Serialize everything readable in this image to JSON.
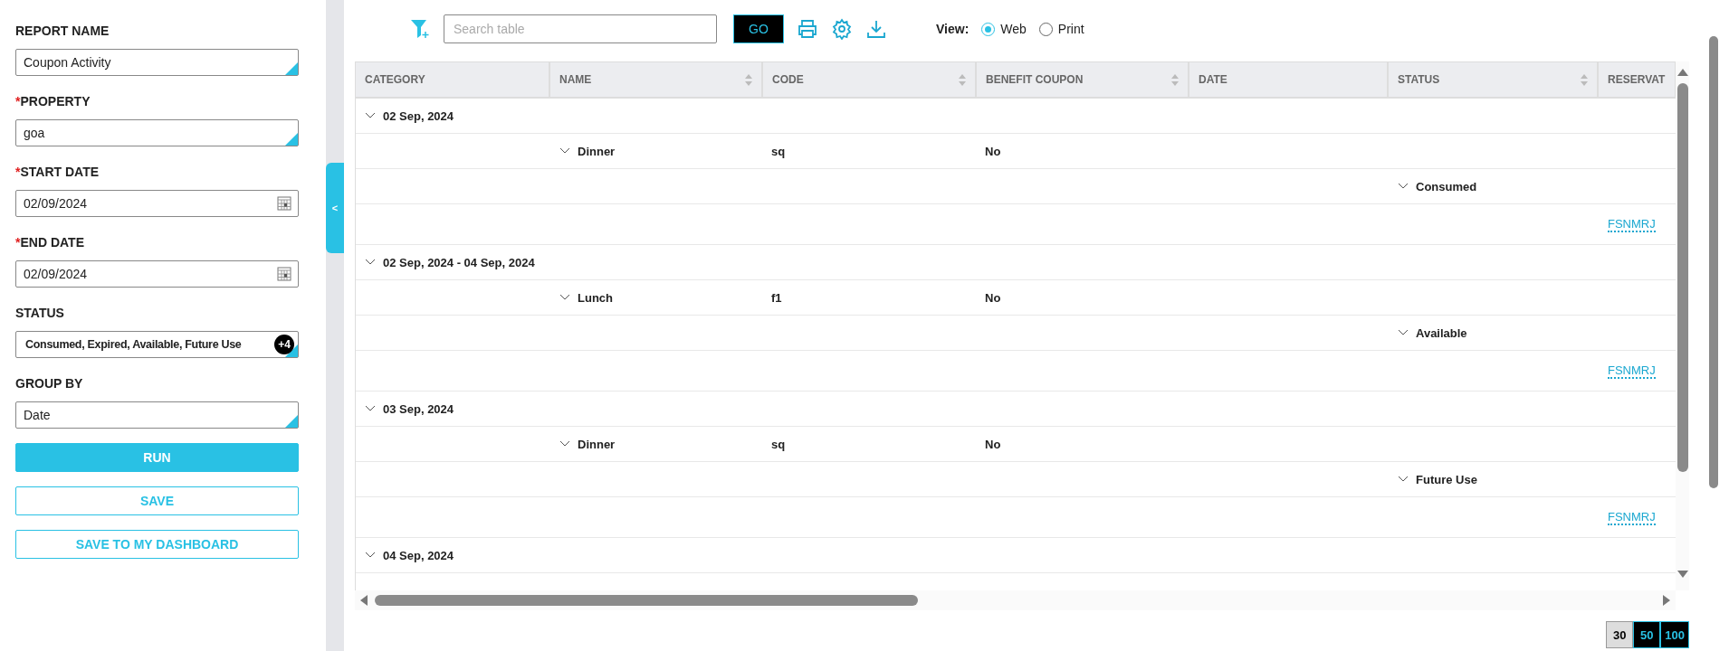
{
  "sidebar": {
    "fields": [
      {
        "label": "REPORT NAME",
        "kind": "select",
        "value": "Coupon Activity"
      },
      {
        "label": "PROPERTY",
        "mark": "*",
        "kind": "select",
        "value": "goa"
      },
      {
        "label": "START DATE",
        "mark": "*",
        "kind": "date",
        "value": "02/09/2024"
      },
      {
        "label": "END DATE",
        "mark": "*",
        "kind": "date",
        "value": "02/09/2024"
      },
      {
        "label": "STATUS",
        "kind": "multi",
        "value": "Consumed, Expired, Available, Future Use",
        "badge": "+4"
      },
      {
        "label": "GROUP BY",
        "kind": "select",
        "value": "Date"
      }
    ],
    "buttons": [
      {
        "label": "RUN",
        "kind": "primary"
      },
      {
        "label": "SAVE",
        "kind": "outline"
      },
      {
        "label": "SAVE TO MY DASHBOARD",
        "kind": "outline"
      }
    ],
    "collapse_toggle": "<"
  },
  "toolbar": {
    "search": {
      "placeholder": "Search table"
    },
    "go": "GO",
    "view_label": "View:",
    "view_options": [
      {
        "label": "Web",
        "selected": true
      },
      {
        "label": "Print",
        "selected": false
      }
    ]
  },
  "table": {
    "columns": [
      {
        "label": "CATEGORY"
      },
      {
        "label": "NAME",
        "sortable": true
      },
      {
        "label": "CODE",
        "sortable": true
      },
      {
        "label": "BENEFIT COUPON",
        "sortable": true
      },
      {
        "label": "DATE"
      },
      {
        "label": "STATUS",
        "sortable": true
      },
      {
        "label": "RESERVAT"
      }
    ],
    "groups": [
      {
        "label": "02 Sep, 2024",
        "expanded": true,
        "items": [
          {
            "name": "Dinner",
            "code": "sq",
            "benefit": "No",
            "expanded": true,
            "statuses": [
              {
                "status": "Consumed",
                "expanded": true,
                "reservations": [
                  "FSNMRJ"
                ]
              }
            ]
          }
        ]
      },
      {
        "label": "02 Sep, 2024 - 04 Sep, 2024",
        "expanded": true,
        "items": [
          {
            "name": "Lunch",
            "code": "f1",
            "benefit": "No",
            "expanded": true,
            "statuses": [
              {
                "status": "Available",
                "expanded": true,
                "reservations": [
                  "FSNMRJ"
                ]
              }
            ]
          }
        ]
      },
      {
        "label": "03 Sep, 2024",
        "expanded": true,
        "items": [
          {
            "name": "Dinner",
            "code": "sq",
            "benefit": "No",
            "expanded": true,
            "statuses": [
              {
                "status": "Future Use",
                "expanded": true,
                "reservations": [
                  "FSNMRJ"
                ]
              }
            ]
          }
        ]
      },
      {
        "label": "04 Sep, 2024",
        "expanded": true
      }
    ]
  },
  "pager": [
    {
      "label": "30",
      "selected": true
    },
    {
      "label": "50",
      "selected": false
    },
    {
      "label": "100",
      "selected": false
    }
  ]
}
